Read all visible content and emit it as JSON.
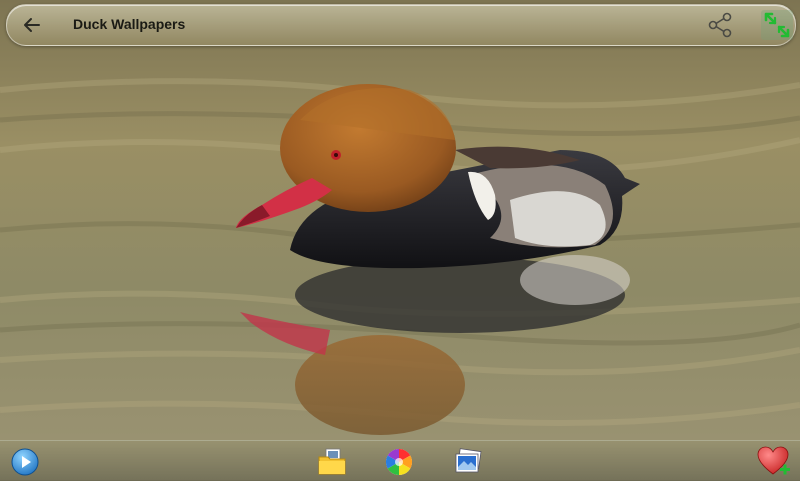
{
  "app": {
    "title": "Duck Wallpapers"
  },
  "icons": {
    "back": "arrow-back-icon",
    "share": "share-icon",
    "fullscreen": "fullscreen-toggle-icon",
    "play": "play-icon",
    "folder": "folder-icon",
    "color_wheel": "color-wheel-icon",
    "gallery": "gallery-icon",
    "favorite": "favorite-add-icon"
  },
  "colors": {
    "title_text": "#1a1a14",
    "fullscreen_accent": "#22bb33",
    "favorite_red": "#d42a2a",
    "favorite_plus": "#22bb33"
  }
}
